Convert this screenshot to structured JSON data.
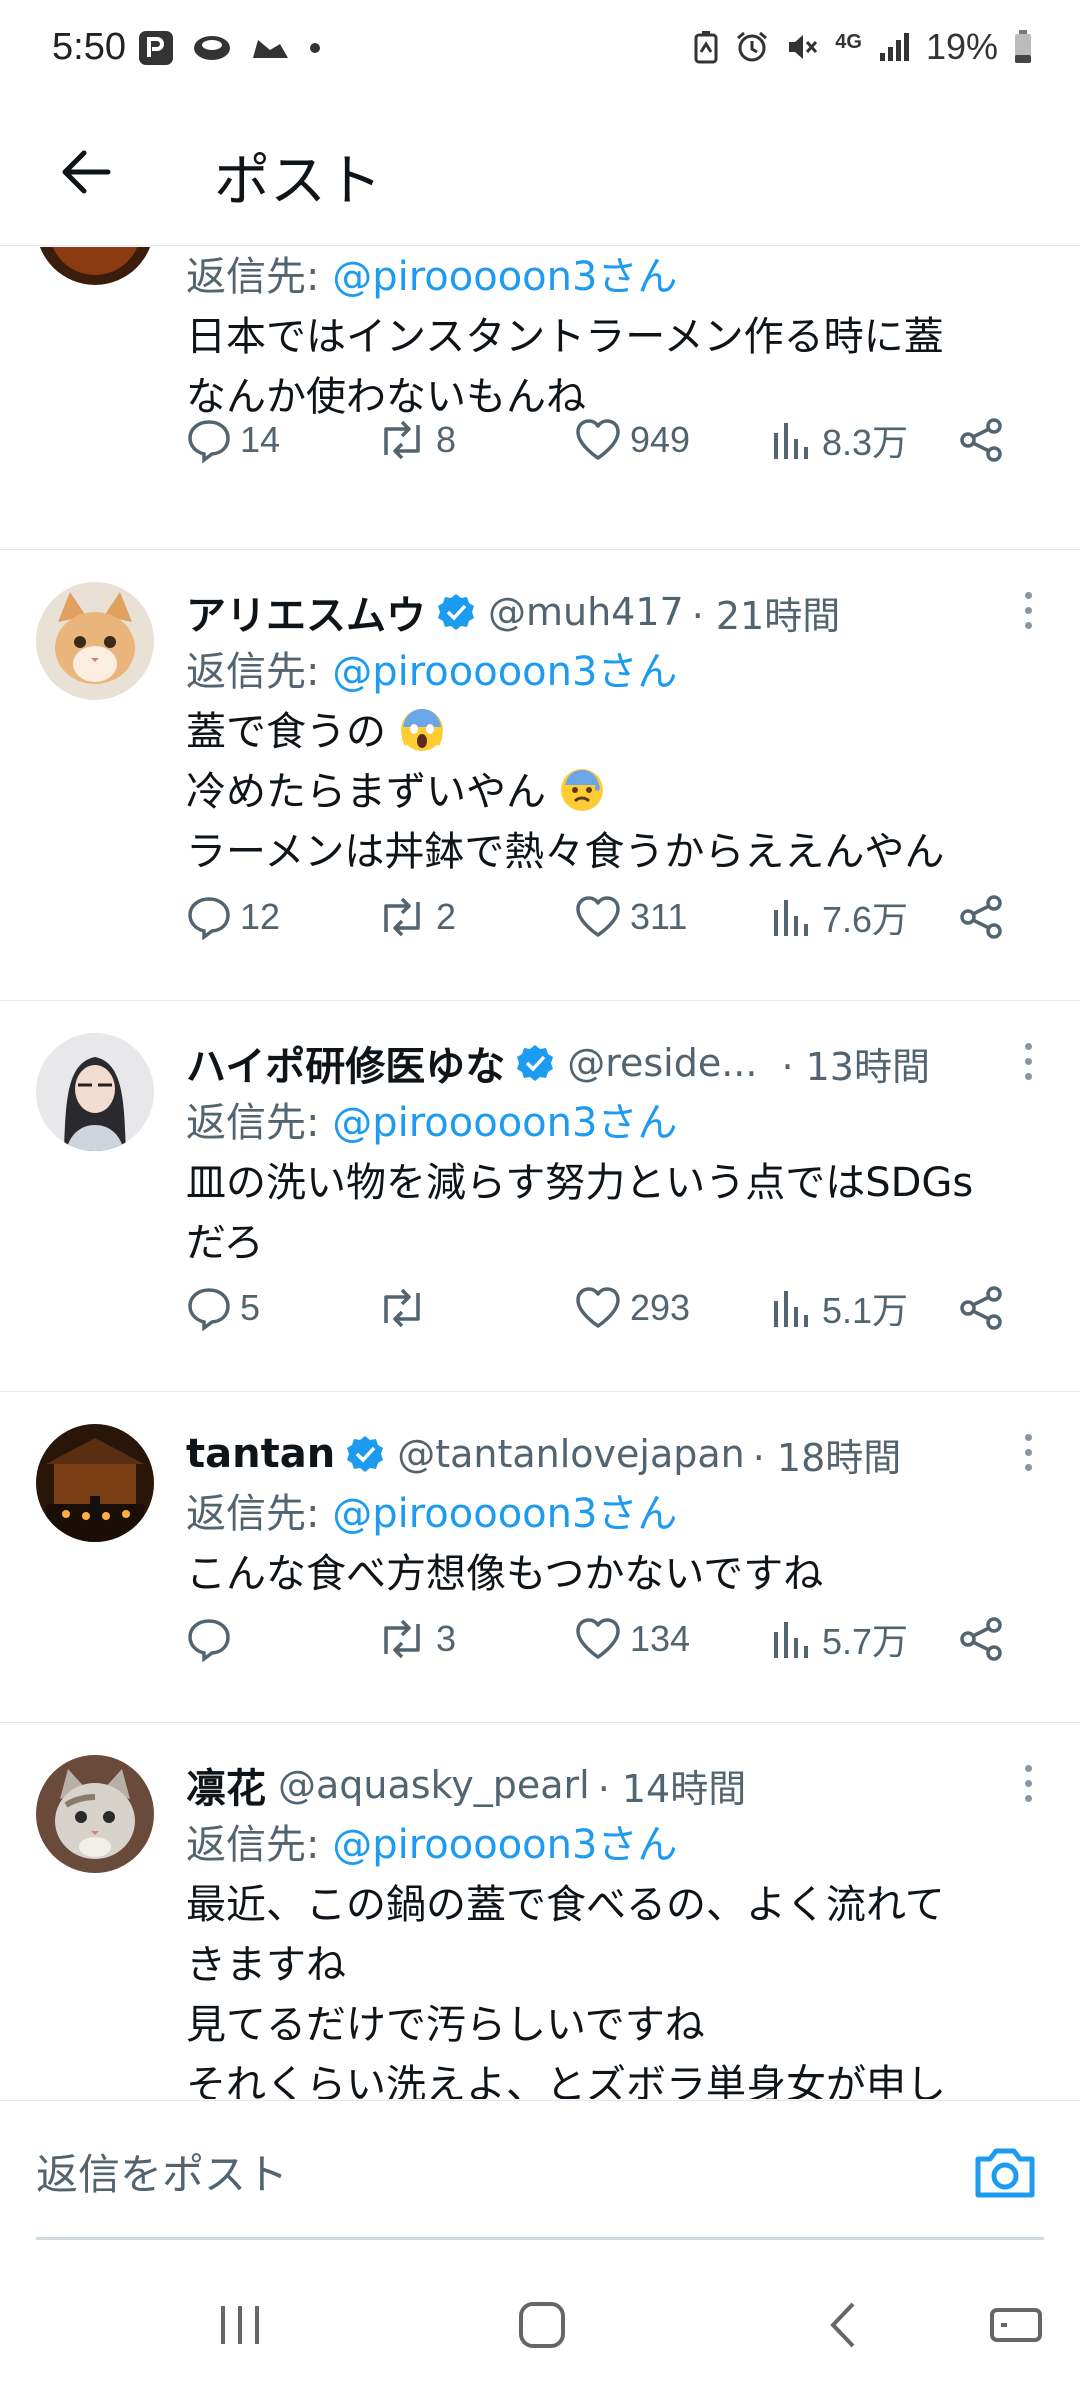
{
  "status_bar": {
    "time": "5:50",
    "network": "4G",
    "battery": "19%",
    "left_icons": [
      "paypay-icon",
      "app-icon",
      "sneaker-icon",
      "dot-icon"
    ],
    "right_icons": [
      "battery-saver-icon",
      "alarm-icon",
      "mute-icon",
      "network-4g-icon",
      "signal-icon",
      "battery-icon"
    ]
  },
  "header": {
    "title": "ポスト",
    "back_icon": "arrow-left-icon"
  },
  "colors": {
    "accent": "#1d9bf0",
    "text": "#0f1419",
    "muted": "#536471",
    "divider": "#e6e9eb"
  },
  "posts": [
    {
      "reply_to_prefix": "返信先: ",
      "reply_to_handle": "@pirooooon3さん",
      "lines": [
        "日本ではインスタントラーメン作る時に蓋",
        "なんか使わないもんね"
      ],
      "stats": {
        "replies": "14",
        "reposts": "8",
        "likes": "949",
        "views": "8.3万"
      }
    },
    {
      "name": "アリエスムウ",
      "verified": true,
      "handle": "@muh417",
      "time": "· 21時間",
      "reply_to_prefix": "返信先: ",
      "reply_to_handle": "@pirooooon3さん",
      "lines": [
        "蓋で食うの",
        "冷めたらまずいやん",
        "ラーメンは丼鉢で熱々食うからええんやん"
      ],
      "stats": {
        "replies": "12",
        "reposts": "2",
        "likes": "311",
        "views": "7.6万"
      }
    },
    {
      "name": "ハイポ研修医ゆな",
      "verified": true,
      "handle": "@reside...",
      "time": "· 13時間",
      "reply_to_prefix": "返信先: ",
      "reply_to_handle": "@pirooooon3さん",
      "lines": [
        "皿の洗い物を減らす努力という点ではSDGs",
        "だろ"
      ],
      "stats": {
        "replies": "5",
        "reposts": "",
        "likes": "293",
        "views": "5.1万"
      }
    },
    {
      "name": "tantan",
      "verified": true,
      "handle": "@tantanlovejapan",
      "time": "· 18時間",
      "reply_to_prefix": "返信先: ",
      "reply_to_handle": "@pirooooon3さん",
      "lines": [
        "こんな食べ方想像もつかないですね"
      ],
      "stats": {
        "replies": "",
        "reposts": "3",
        "likes": "134",
        "views": "5.7万"
      }
    },
    {
      "name": "凛花",
      "verified": false,
      "handle": "@aquasky_pearl",
      "time": "· 14時間",
      "reply_to_prefix": "返信先: ",
      "reply_to_handle": "@pirooooon3さん",
      "lines": [
        "最近、この鍋の蓋で食べるの、よく流れて",
        "きますね",
        "見てるだけで汚らしいですね",
        "それくらい洗えよ、とズボラ単身女が申し"
      ]
    }
  ],
  "reply_bar": {
    "placeholder": "返信をポスト",
    "camera_icon": "camera-icon"
  },
  "nav_bar": {
    "icons": [
      "recent-apps-icon",
      "home-icon",
      "back-icon",
      "keyboard-icon"
    ]
  }
}
